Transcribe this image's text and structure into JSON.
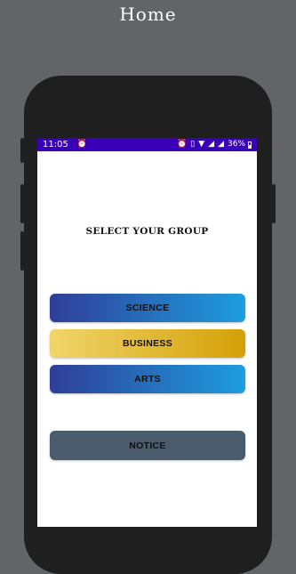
{
  "caption": "Home",
  "status_bar": {
    "time": "11:05",
    "battery": "36%",
    "icons": [
      "alarm-icon",
      "alarm-icon",
      "vibrate-icon",
      "wifi-icon",
      "signal-icon",
      "signal-icon",
      "battery-icon"
    ]
  },
  "screen": {
    "title": "SELECT YOUR GROUP",
    "buttons": {
      "science": "SCIENCE",
      "business": "BUSINESS",
      "arts": "ARTS",
      "notice": "NOTICE"
    }
  },
  "colors": {
    "status_bar": "#3a00b8",
    "science_gradient": [
      "#2f3e98",
      "#1d9ddf"
    ],
    "business_gradient": [
      "#f0d56a",
      "#d4a007"
    ],
    "notice": "#4a5c6b"
  }
}
